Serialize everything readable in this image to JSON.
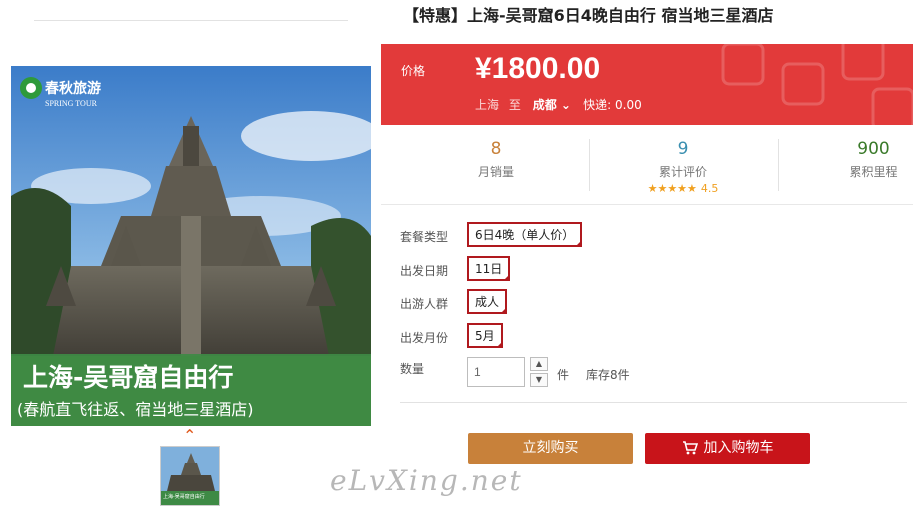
{
  "product": {
    "title": "【特惠】上海-吴哥窟6日4晚自由行 宿当地三星酒店",
    "image": {
      "brand_cn": "春秋旅游",
      "brand_en": "SPRING TOUR",
      "headline": "上海-吴哥窟自由行",
      "subline": "(春航直飞往返、宿当地三星酒店)"
    },
    "thumb": {
      "caption": "上海-吴哥窟自由行"
    },
    "thumb_nav_arrow": "⌃"
  },
  "price": {
    "label": "价格",
    "value": "¥1800.00",
    "from": "上海",
    "to_word": "至",
    "to_city": "成都",
    "to_arrow": "⌄",
    "shipping": "快递: 0.00"
  },
  "stats": {
    "monthly_sales": {
      "value": "8",
      "label": "月销量"
    },
    "reviews": {
      "value": "9",
      "label": "累计评价",
      "stars": "★★★★★",
      "score": "4.5",
      "rating": 4.5
    },
    "points": {
      "value": "900",
      "label": "累积里程"
    }
  },
  "options": [
    {
      "label": "套餐类型",
      "value": "6日4晚（单人价）"
    },
    {
      "label": "出发日期",
      "value": "11日"
    },
    {
      "label": "出游人群",
      "value": "成人"
    },
    {
      "label": "出发月份",
      "value": "5月"
    }
  ],
  "quantity": {
    "label": "数量",
    "value": "1",
    "unit": "件",
    "stock": "库存8件",
    "up_icon": "▲",
    "down_icon": "▼"
  },
  "actions": {
    "buy_now": "立刻购买",
    "add_to_cart": "加入购物车"
  },
  "watermark": "eLvXing.net",
  "colors": {
    "price_bg": "#e23a3a",
    "buy_btn": "#c8813a",
    "cart_btn": "#c8141a",
    "option_border": "#b0191e",
    "sales_color": "#c8813a",
    "reviews_color": "#3a8fb0",
    "points_color": "#3a7a2a"
  }
}
